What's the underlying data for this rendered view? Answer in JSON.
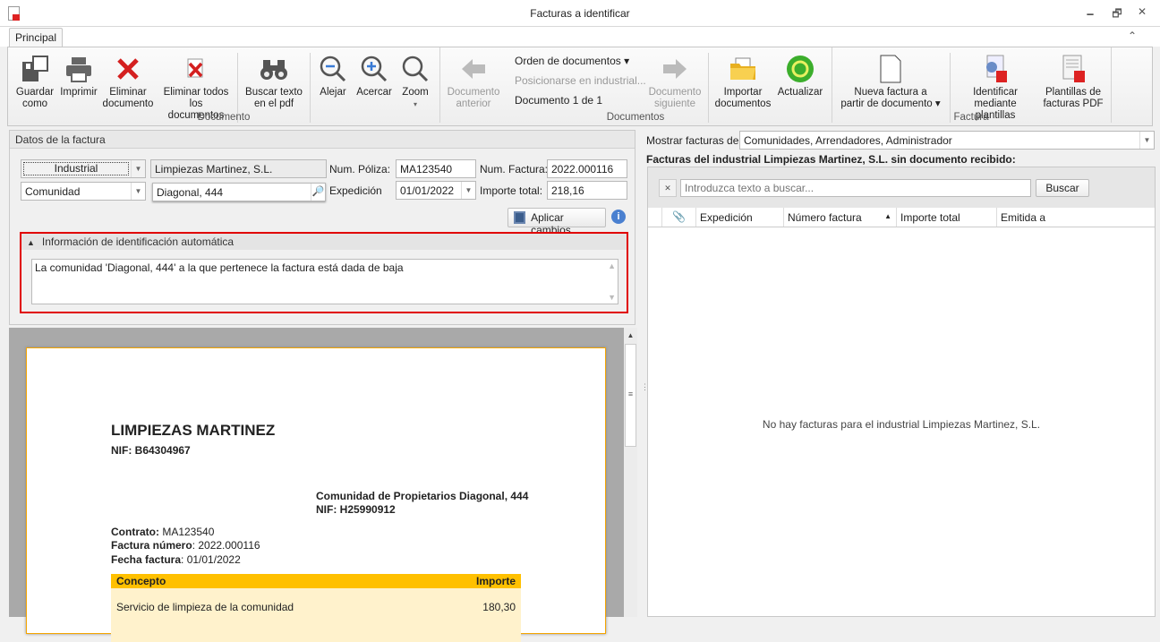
{
  "window": {
    "title": "Facturas a identificar",
    "minimize": "🗕",
    "restore": "🗗",
    "close": "✕",
    "collapse_ribbon": "⌃"
  },
  "tabs": [
    {
      "label": "Principal"
    }
  ],
  "ribbon": {
    "groups": [
      "Documento",
      "Documentos",
      "Factura"
    ],
    "buttons": {
      "guardar": [
        "Guardar",
        "como"
      ],
      "imprimir": [
        "Imprimir",
        ""
      ],
      "eliminar": [
        "Eliminar",
        "documento"
      ],
      "eliminar_todos": [
        "Eliminar todos",
        "los documentos"
      ],
      "buscar": [
        "Buscar texto",
        "en el pdf"
      ],
      "alejar": [
        "Alejar",
        ""
      ],
      "acercar": [
        "Acercar",
        ""
      ],
      "zoom": [
        "Zoom",
        "▾"
      ],
      "anterior": [
        "Documento",
        "anterior"
      ],
      "siguiente": [
        "Documento",
        "siguiente"
      ],
      "importar": [
        "Importar",
        "documentos"
      ],
      "actualizar": [
        "Actualizar",
        ""
      ],
      "nueva": [
        "Nueva factura a",
        "partir de documento ▾"
      ],
      "identificar": [
        "Identificar",
        "mediante plantillas"
      ],
      "plantillas": [
        "Plantillas de",
        "facturas PDF"
      ]
    },
    "orden": "Orden de documentos ▾",
    "posicionarse": "Posicionarse en industrial...",
    "doc_count": "Documento 1 de 1"
  },
  "invoice_data": {
    "title": "Datos de la factura",
    "tipo_button": "Industrial",
    "industrial_name": "Limpiezas Martinez, S.L.",
    "tipo2": "Comunidad",
    "comunidad": "Diagonal, 444",
    "poliza_label": "Num. Póliza:",
    "poliza": "MA123540",
    "factura_label": "Num. Factura:",
    "factura": "2022.000116",
    "expedicion_label": "Expedición",
    "expedicion": "01/01/2022",
    "importe_label": "Importe total:",
    "importe": "218,16",
    "apply": "Aplicar cambios",
    "auto_title": "Información de identificación automática",
    "auto_message": "La comunidad 'Diagonal, 444' a la que pertenece la factura está dada de baja",
    "alert_color": "#e00000"
  },
  "pdf": {
    "company": "LIMPIEZAS MARTINEZ",
    "nif": "NIF: B64304967",
    "client": "Comunidad de Propietarios Diagonal, 444",
    "client_nif": "NIF: H25990912",
    "contrato_label": "Contrato:",
    "contrato": " MA123540",
    "numero_label": "Factura número",
    "numero": ": 2022.000116",
    "fecha_label": "Fecha factura",
    "fecha": ": 01/01/2022",
    "table_header": [
      "Concepto",
      "Importe"
    ],
    "rows": [
      {
        "concepto": "Servicio de limpieza de la comunidad",
        "importe": "180,30"
      }
    ],
    "header_color": "#ffc000",
    "row_color": "#fff2cc"
  },
  "right": {
    "show_label": "Mostrar facturas de:",
    "show_value": "Comunidades, Arrendadores, Administrador",
    "heading": "Facturas del industrial Limpiezas Martinez, S.L. sin documento recibido:",
    "search_placeholder": "Introduzca texto a buscar...",
    "search_button": "Buscar",
    "clear": "✕",
    "columns": [
      "",
      "Expedición",
      "Número factura",
      "Importe total",
      "Emitida a"
    ],
    "sort_indicator": "▲",
    "empty": "No hay facturas para el industrial Limpiezas Martinez, S.L."
  }
}
